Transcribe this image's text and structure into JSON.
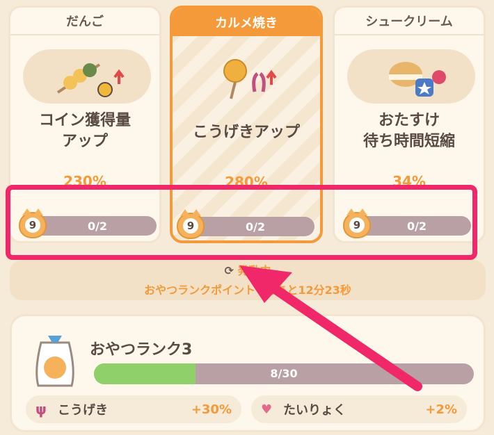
{
  "cards": [
    {
      "name": "だんご",
      "desc": "コイン獲得量\nアップ",
      "pct": "230%",
      "level": "9",
      "progress": "0/2",
      "icon": "dango-icon",
      "selected": false
    },
    {
      "name": "カルメ焼き",
      "desc": "こうげきアップ",
      "pct": "280%",
      "level": "9",
      "progress": "0/2",
      "icon": "karumeyaki-icon",
      "selected": true
    },
    {
      "name": "シュークリーム",
      "desc": "おたすけ\n待ち時間短縮",
      "pct": "34%",
      "level": "9",
      "progress": "0/2",
      "icon": "cream-puff-icon",
      "selected": false
    }
  ],
  "status": {
    "top": "発動中",
    "bottom": "おやつランクポイント+",
    "bottom_time": "であと12分23秒",
    "refresh_icon": "refresh-icon"
  },
  "rank": {
    "title": "おやつランク3",
    "progress_label": "8/30",
    "progress_fraction": 0.2667,
    "stats": [
      {
        "label": "こうげき",
        "value": "+30%",
        "icon": "attack-icon"
      },
      {
        "label": "たいりょく",
        "value": "+2%",
        "icon": "heart-icon"
      }
    ]
  },
  "colors": {
    "accent": "#f49a3a",
    "highlight": "#f0286a",
    "bar": "#b9a0a4",
    "fill": "#8fd06b"
  }
}
